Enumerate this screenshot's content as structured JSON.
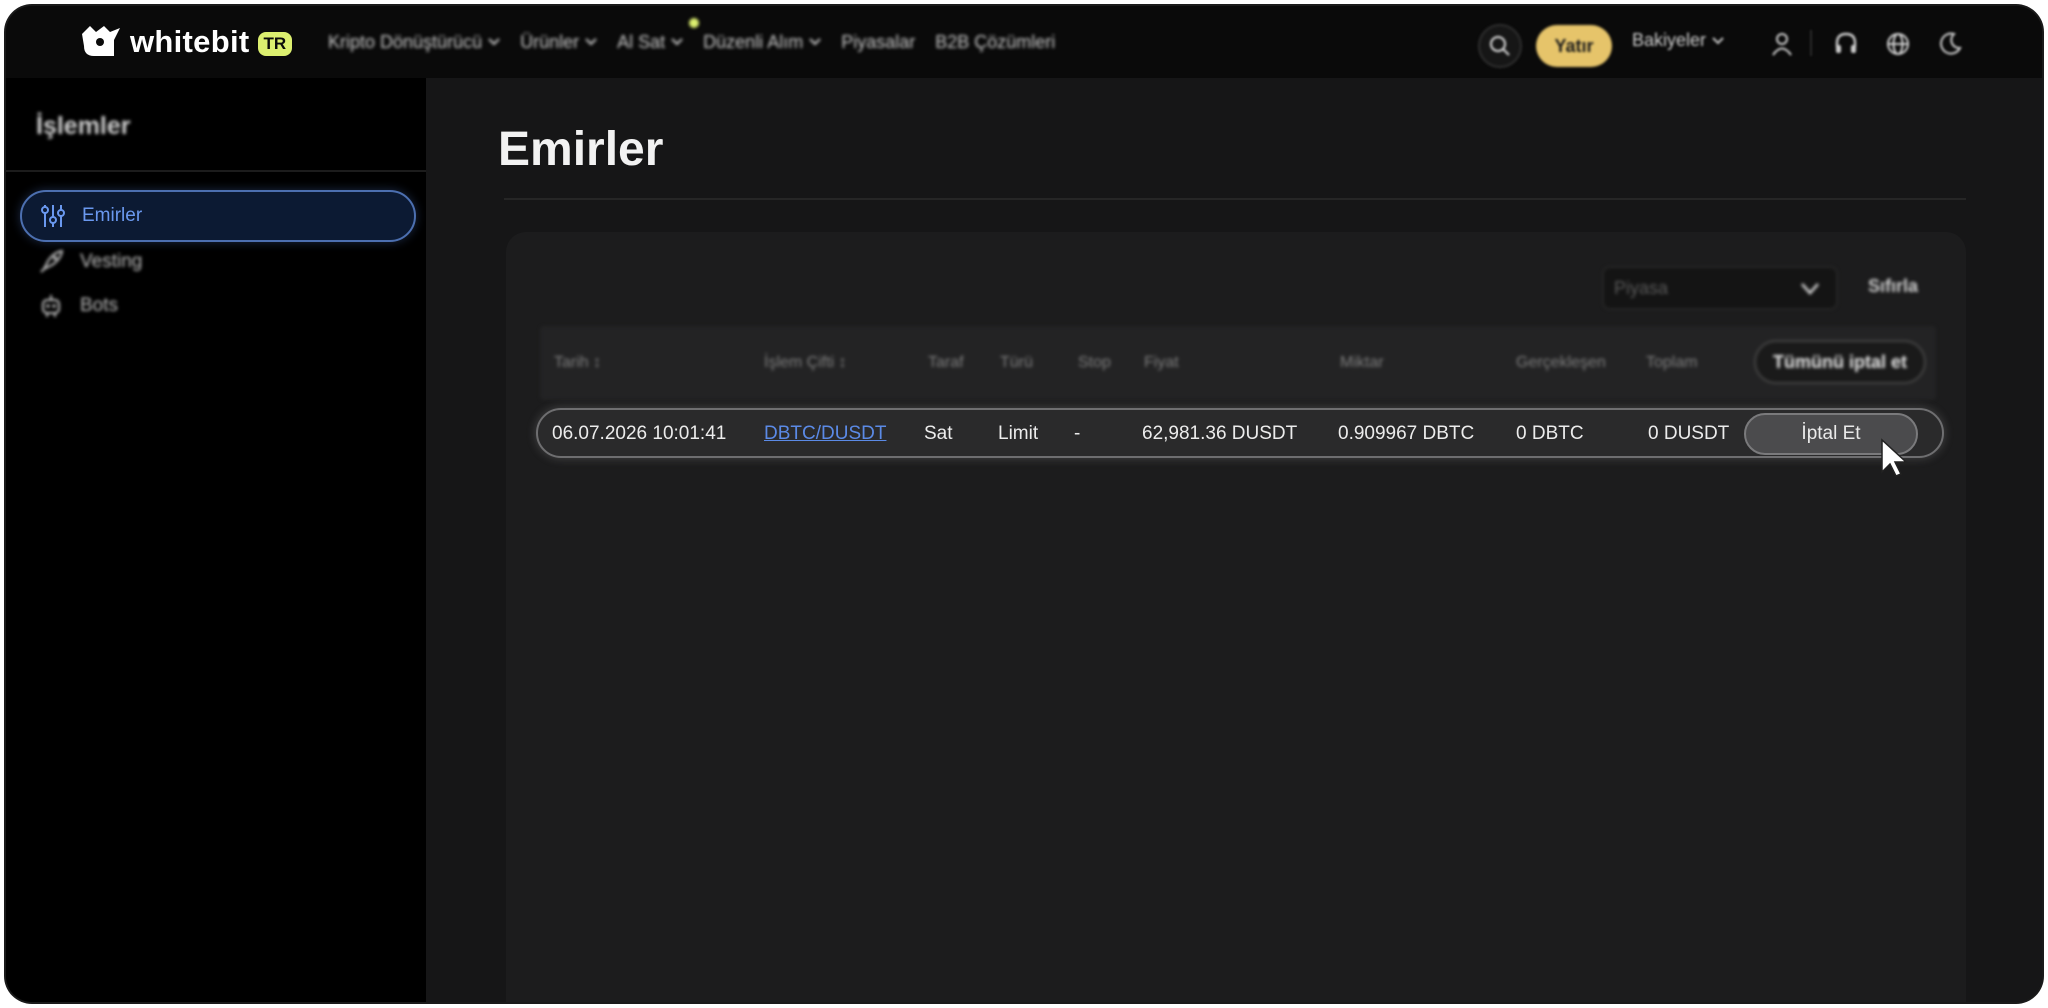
{
  "brand": {
    "name": "whitebit",
    "badge": "TR"
  },
  "nav": {
    "items": [
      {
        "label": "Kripto Dönüştürücü",
        "has_dropdown": true
      },
      {
        "label": "Ürünler",
        "has_dropdown": true
      },
      {
        "label": "Al Sat",
        "has_dropdown": true,
        "has_dot": true
      },
      {
        "label": "Düzenli Alım",
        "has_dropdown": true
      },
      {
        "label": "Piyasalar",
        "has_dropdown": false
      },
      {
        "label": "B2B Çözümleri",
        "has_dropdown": false
      }
    ]
  },
  "toolbar": {
    "search_icon": "search-icon",
    "deposit_label": "Yatır",
    "balances_label": "Bakiyeler",
    "icons": [
      "user-icon",
      "headset-icon",
      "globe-icon",
      "moon-icon"
    ]
  },
  "sidebar": {
    "title": "İşlemler",
    "items": [
      {
        "label": "Emirler",
        "icon": "sliders-icon",
        "active": true
      },
      {
        "label": "Vesting",
        "icon": "rocket-icon",
        "active": false
      },
      {
        "label": "Bots",
        "icon": "robot-icon",
        "active": false
      }
    ]
  },
  "main": {
    "title": "Emirler",
    "filter": {
      "market_placeholder": "Piyasa",
      "reset_label": "Sıfırla"
    },
    "table": {
      "columns": [
        "Tarih",
        "İşlem Çifti",
        "Taraf",
        "Türü",
        "Stop",
        "Fiyat",
        "Miktar",
        "Gerçekleşen",
        "Toplam"
      ],
      "cancel_all_label": "Tümünü iptal et",
      "rows": [
        {
          "date": "06.07.2026 10:01:41",
          "pair": "DBTC/DUSDT",
          "side": "Sat",
          "type": "Limit",
          "stop": "-",
          "price": "62,981.36 DUSDT",
          "amount": "0.909967 DBTC",
          "filled": "0 DBTC",
          "total": "0 DUSDT",
          "cancel_label": "İptal Et"
        }
      ]
    }
  },
  "colors": {
    "accent_blue": "#5b8ae6",
    "deposit_yellow": "#e6c46a",
    "badge_lime": "#dcef6f",
    "background": "#161617",
    "sidebar_bg": "#000000"
  }
}
